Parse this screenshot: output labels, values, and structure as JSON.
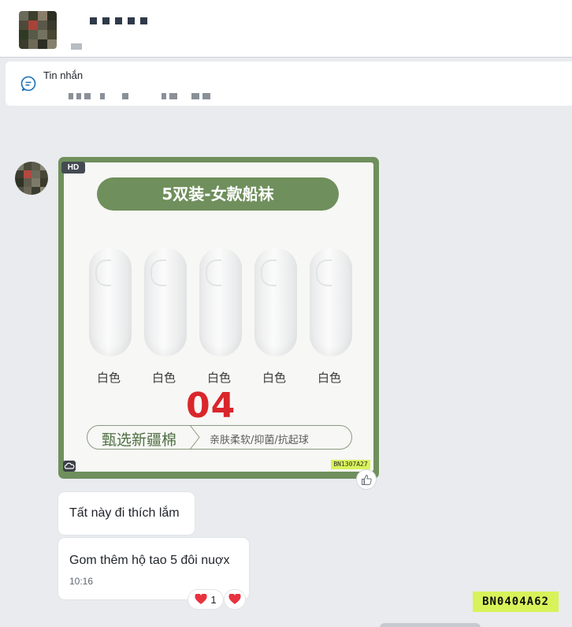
{
  "header": {
    "contact_name_blurred": "",
    "avatar_colors": [
      "#6b6b5a",
      "#3d3f2e",
      "#8a7d6a",
      "#2c2e22",
      "#4e4a3a",
      "#a8433a",
      "#5a5848",
      "#3a3b2c",
      "#2f3a24",
      "#585a48",
      "#74725f",
      "#494733",
      "#3b3c2c",
      "#6e6a58",
      "#2b2d22",
      "#85806d"
    ]
  },
  "pinned": {
    "title": "Tin nhắn",
    "icon": "message-circle-icon"
  },
  "message_avatar_colors": [
    "#7a7666",
    "#4a4a3a",
    "#5d5b4c",
    "#8b8878",
    "#3c3d30",
    "#b24a40",
    "#6d6a5a",
    "#474636",
    "#2f3326",
    "#5e5c4c",
    "#7e7a69",
    "#3a3a2d",
    "#514f40",
    "#6b6858",
    "#3b3c30",
    "#8c8774"
  ],
  "image_message": {
    "hd_badge": "HD",
    "title": "5双装-女款船袜",
    "sock_labels": [
      "白色",
      "白色",
      "白色",
      "白色",
      "白色"
    ],
    "number": "04",
    "feature_left": "甄选新疆棉",
    "feature_right": "亲肤柔软/抑菌/抗起球",
    "code": "BN1307A27",
    "accent_color": "#6f8f5c"
  },
  "messages": [
    {
      "text": "Tất này đi thích lắm"
    },
    {
      "text": "Gom thêm hộ tao 5 đôi nuợx",
      "time": "10:16"
    }
  ],
  "reactions": [
    {
      "emoji": "heart-icon",
      "count": "1"
    },
    {
      "emoji": "heart-icon"
    }
  ],
  "watermark": "BN0404A62"
}
